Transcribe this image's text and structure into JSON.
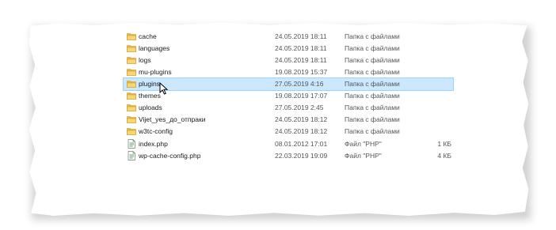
{
  "files": [
    {
      "name": "cache",
      "date": "24.05.2019 18:11",
      "type": "Папка с файлами",
      "size": "",
      "icon": "folder-icon"
    },
    {
      "name": "languages",
      "date": "24.05.2019 18:11",
      "type": "Папка с файлами",
      "size": "",
      "icon": "folder-icon"
    },
    {
      "name": "logs",
      "date": "24.05.2019 18:11",
      "type": "Папка с файлами",
      "size": "",
      "icon": "folder-icon"
    },
    {
      "name": "mu-plugins",
      "date": "19.08.2019 15:37",
      "type": "Папка с файлами",
      "size": "",
      "icon": "folder-icon"
    },
    {
      "name": "plugins",
      "date": "27.05.2019 4:16",
      "type": "Папка с файлами",
      "size": "",
      "icon": "folder-icon",
      "selected": true
    },
    {
      "name": "themes",
      "date": "19.08.2019 17:07",
      "type": "Папка с файлами",
      "size": "",
      "icon": "folder-icon"
    },
    {
      "name": "uploads",
      "date": "27.05.2019 2:45",
      "type": "Папка с файлами",
      "size": "",
      "icon": "folder-icon"
    },
    {
      "name": "Vijet_yes_до_отпраки",
      "date": "24.05.2019 18:12",
      "type": "Папка с файлами",
      "size": "",
      "icon": "folder-icon"
    },
    {
      "name": "w3tc-config",
      "date": "24.05.2019 18:12",
      "type": "Папка с файлами",
      "size": "",
      "icon": "folder-icon"
    },
    {
      "name": "index.php",
      "date": "08.01.2012 17:01",
      "type": "Файл \"PHP\"",
      "size": "1 КБ",
      "icon": "php-file-icon"
    },
    {
      "name": "wp-cache-config.php",
      "date": "22.03.2019 19:09",
      "type": "Файл \"PHP\"",
      "size": "4 КБ",
      "icon": "php-file-icon"
    }
  ],
  "colors": {
    "selection_bg": "#cce8ff",
    "selection_border": "#99d1ff",
    "folder": "#e8b93b"
  }
}
